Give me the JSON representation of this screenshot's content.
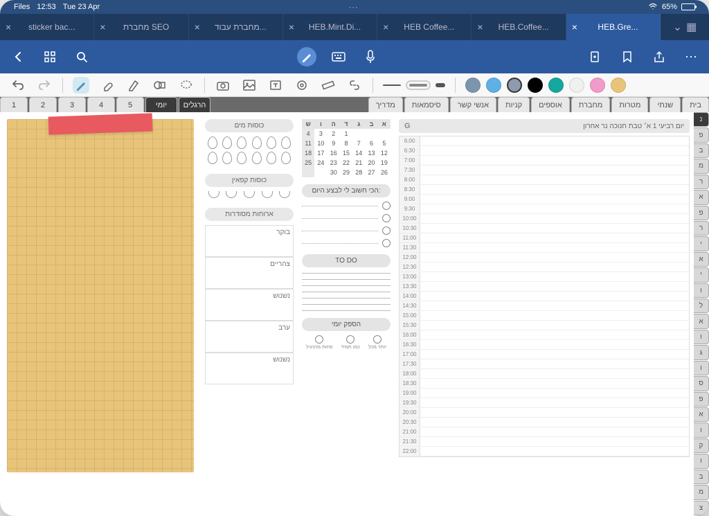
{
  "status": {
    "files": "Files",
    "time": "12:53",
    "date": "Tue 23 Apr",
    "battery": "65%"
  },
  "tabs": [
    {
      "label": "sticker bac..."
    },
    {
      "label": "מחברת SEO"
    },
    {
      "label": "מחברת עבוד..."
    },
    {
      "label": "HEB.Mint.Di..."
    },
    {
      "label": "HEB Coffee..."
    },
    {
      "label": "HEB.Coffee..."
    },
    {
      "label": "HEB.Gre...",
      "active": true
    }
  ],
  "numTabs": [
    "1",
    "2",
    "3",
    "4",
    "5"
  ],
  "darkTabs": [
    "יומי",
    "הרגלים"
  ],
  "navTabs": [
    "מדריך",
    "סיסמאות",
    "אנשי קשר",
    "קניות",
    "אוספים",
    "מחברת",
    "מטרות",
    "שנתי",
    "בית"
  ],
  "sideTabs": [
    "נ",
    "פ",
    "ב",
    "מ",
    "ר",
    "א",
    "פ",
    "ר",
    "י",
    "א",
    "י",
    "ו",
    "ל",
    "א",
    "ו",
    "ג",
    "ו",
    "ס",
    "פ",
    "א",
    "ו",
    "ק",
    "ו",
    "ב",
    "מ",
    "צ"
  ],
  "trackers": {
    "water": "כוסות מים",
    "caffeine": "כוסות קפאין",
    "meals": "ארוחות מסודרות",
    "mealLabels": [
      "בוקר",
      "צהריים",
      "נשנוש",
      "ערב",
      "נשנוש"
    ]
  },
  "calendar": {
    "days": [
      "ש",
      "ו",
      "ה",
      "ד",
      "ג",
      "ב",
      "א"
    ],
    "rows": [
      [
        "4",
        "3",
        "2",
        "1",
        "",
        "",
        ""
      ],
      [
        "11",
        "10",
        "9",
        "8",
        "7",
        "6",
        "5"
      ],
      [
        "18",
        "17",
        "16",
        "15",
        "14",
        "13",
        "12"
      ],
      [
        "25",
        "24",
        "23",
        "22",
        "21",
        "20",
        "19"
      ],
      [
        "",
        "",
        "30",
        "29",
        "28",
        "27",
        "26"
      ]
    ]
  },
  "priority": {
    "header": "הכי חשוב לי לבצע היום:",
    "todo": "TO DO",
    "review": "הספק יומי",
    "reviewLabels": [
      "פחות מהרגיל",
      "כמו תמיד",
      "יותר מכל"
    ]
  },
  "schedule": {
    "dateText": "יום רביעי 1 א׳ טבת חנוכה נר אחרון",
    "times": [
      "6:00",
      "6:30",
      "7:00",
      "7:30",
      "8:00",
      "8:30",
      "9:00",
      "9:30",
      "10:00",
      "10:30",
      "11:00",
      "11:30",
      "12:00",
      "12:30",
      "13:00",
      "13:30",
      "14:00",
      "14:30",
      "15:00",
      "15:30",
      "16:00",
      "16:30",
      "17:00",
      "17:30",
      "18:00",
      "18:30",
      "19:00",
      "19:30",
      "20:00",
      "20:30",
      "21:00",
      "21:30",
      "22:00"
    ]
  },
  "colors": [
    "#7d95ac",
    "#5eb0e5",
    "#8e9aad",
    "#000000",
    "#14a89e",
    "#f0f0f0",
    "#f29ac9",
    "#e8c47a"
  ],
  "strokes": [
    {
      "w": 26,
      "h": 2
    },
    {
      "w": 26,
      "h": 4
    },
    {
      "w": 14,
      "h": 6
    }
  ]
}
